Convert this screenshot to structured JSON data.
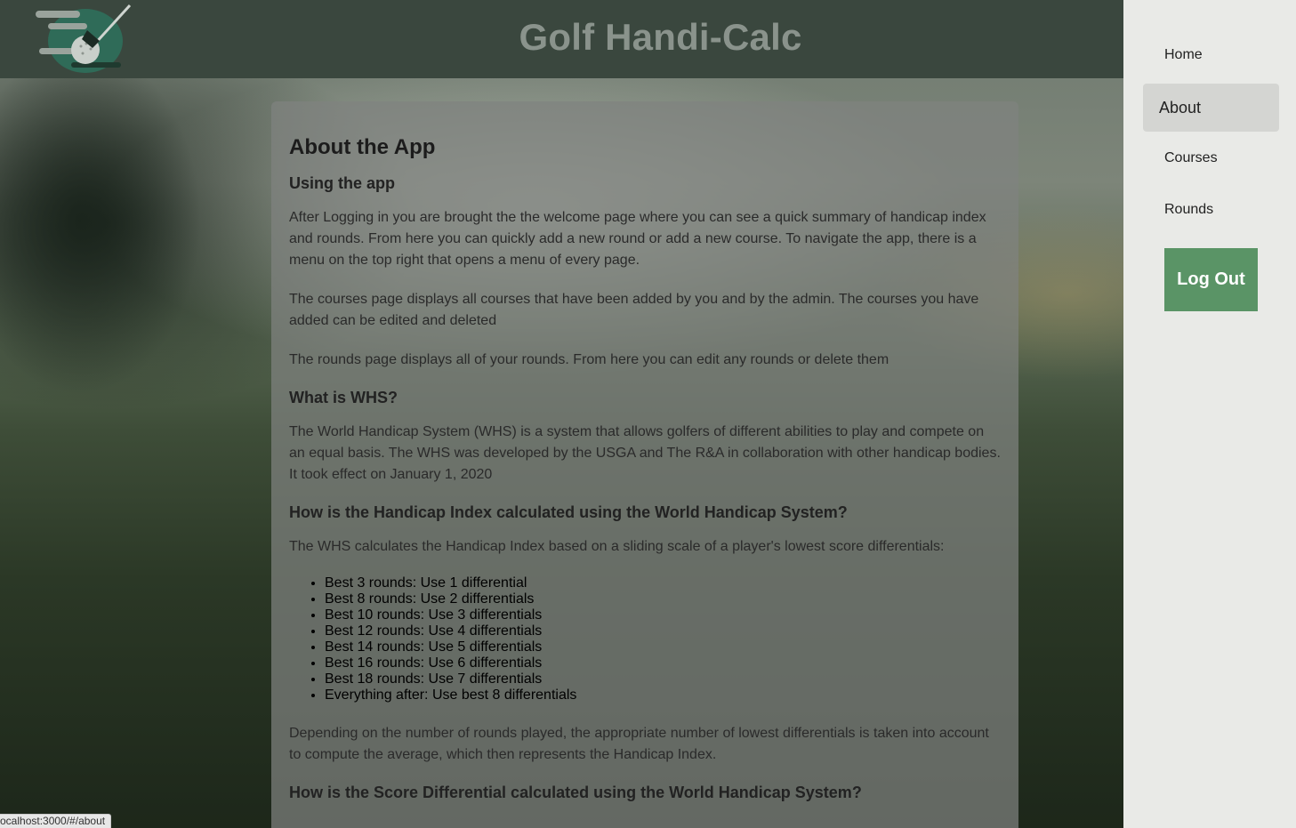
{
  "header": {
    "title": "Golf Handi-Calc",
    "logo_icon": "golf-ball-club-logo-icon"
  },
  "sidebar": {
    "items": [
      {
        "label": "Home",
        "active": false
      },
      {
        "label": "About",
        "active": true
      },
      {
        "label": "Courses",
        "active": false
      },
      {
        "label": "Rounds",
        "active": false
      }
    ],
    "logout_label": "Log Out"
  },
  "about": {
    "page_title": "About the App",
    "using_heading": "Using the app",
    "using_p1": "After Logging in you are brought the the welcome page where you can see a quick summary of handicap index and rounds. From here you can quickly add a new round or add a new course. To navigate the app, there is a menu on the top right that opens a menu of every page.",
    "using_p2": "The courses page displays all courses that have been added by you and by the admin. The courses you have added can be edited and deleted",
    "using_p3": "The rounds page displays all of your rounds. From here you can edit any rounds or delete them",
    "whs_heading": "What is WHS?",
    "whs_p1": "The World Handicap System (WHS) is a system that allows golfers of different abilities to play and compete on an equal basis. The WHS was developed by the USGA and The R&A in collaboration with other handicap bodies. It took effect on January 1, 2020",
    "index_heading": "How is the Handicap Index calculated using the World Handicap System?",
    "index_p1": "The WHS calculates the Handicap Index based on a sliding scale of a player's lowest score differentials:",
    "index_list": [
      "Best 3 rounds: Use 1 differential",
      "Best 8 rounds: Use 2 differentials",
      "Best 10 rounds: Use 3 differentials",
      "Best 12 rounds: Use 4 differentials",
      "Best 14 rounds: Use 5 differentials",
      "Best 16 rounds: Use 6 differentials",
      "Best 18 rounds: Use 7 differentials",
      "Everything after: Use best 8 differentials"
    ],
    "index_p2": "Depending on the number of rounds played, the appropriate number of lowest differentials is taken into account to compute the average, which then represents the Handicap Index.",
    "diff_heading": "How is the Score Differential calculated using the World Handicap System?"
  },
  "status_bar": {
    "url": "ocalhost:3000/#/about"
  },
  "colors": {
    "header_bg": "#3a473e",
    "sidebar_bg": "#e9eae7",
    "logout_bg": "#5a9466",
    "active_nav_bg": "#d4d5d2"
  }
}
